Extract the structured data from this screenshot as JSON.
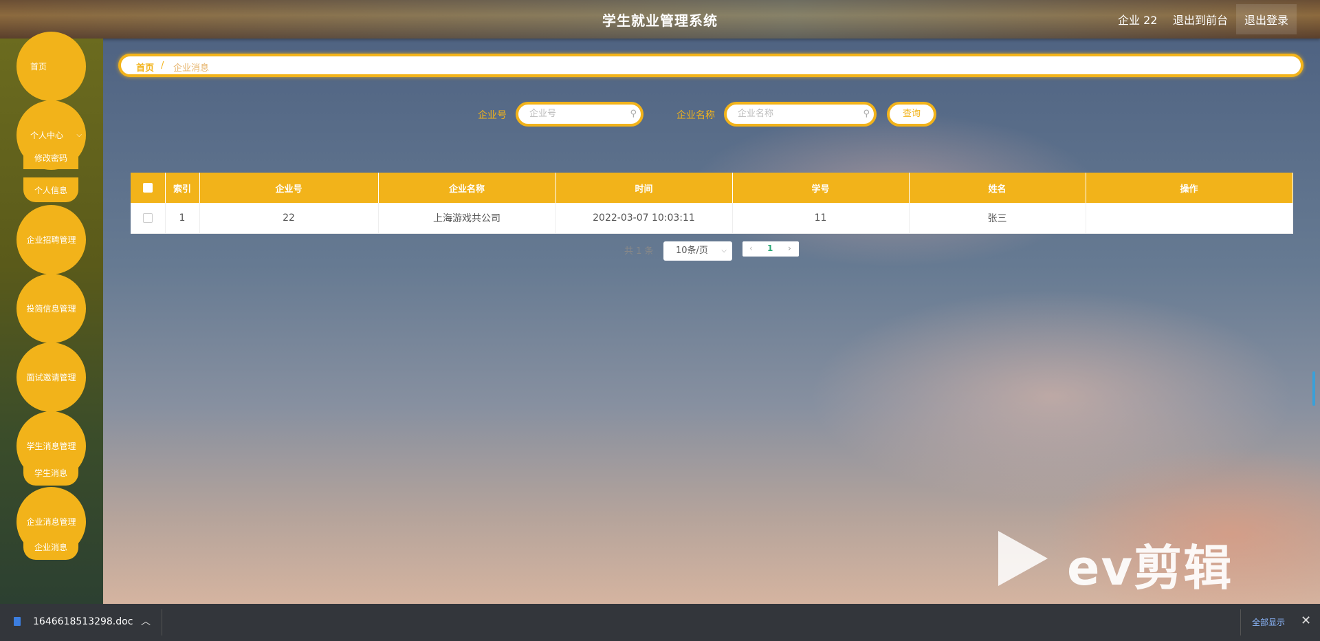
{
  "header": {
    "title": "学生就业管理系统",
    "user": "企业 22",
    "to_front": "退出到前台",
    "logout": "退出登录"
  },
  "sidebar": {
    "home": "首页",
    "personal_center": "个人中心",
    "change_password": "修改密码",
    "personal_info": "个人信息",
    "recruit_mgmt": "企业招聘管理",
    "resume_mgmt": "投简信息管理",
    "interview_mgmt": "面试邀请管理",
    "student_msg_mgmt": "学生消息管理",
    "student_msg": "学生消息",
    "company_msg_mgmt": "企业消息管理",
    "company_msg": "企业消息"
  },
  "breadcrumb": {
    "home": "首页",
    "separator": "/",
    "current": "企业消息"
  },
  "search": {
    "company_no_label": "企业号",
    "company_no_placeholder": "企业号",
    "company_name_label": "企业名称",
    "company_name_placeholder": "企业名称",
    "query_button": "查询"
  },
  "table": {
    "headers": [
      "索引",
      "企业号",
      "企业名称",
      "时间",
      "学号",
      "姓名",
      "操作"
    ],
    "rows": [
      {
        "index": "1",
        "company_no": "22",
        "company_name": "上海游戏共公司",
        "time": "2022-03-07 10:03:11",
        "student_no": "11",
        "name": "张三"
      }
    ]
  },
  "pagination": {
    "total": "共 1 条",
    "page_size": "10条/页",
    "current_page": "1"
  },
  "watermark": {
    "text": "ev剪辑"
  },
  "download_bar": {
    "filename": "1646618513298.doc",
    "show_all": "全部显示"
  },
  "colors": {
    "accent": "#f2b31a",
    "header_text": "#ffffff"
  }
}
